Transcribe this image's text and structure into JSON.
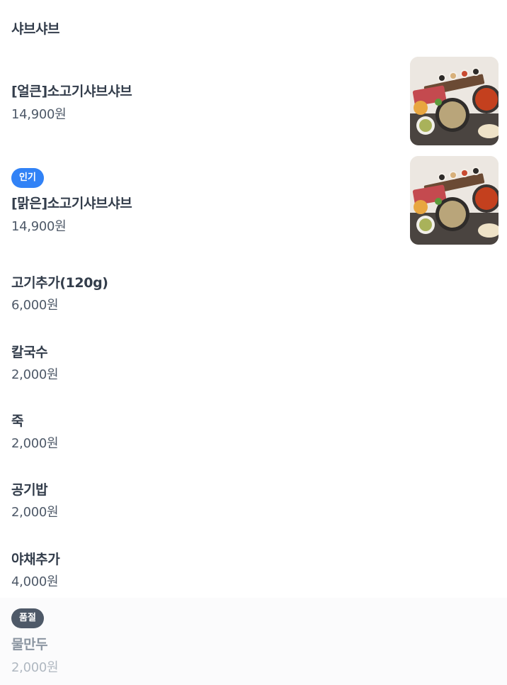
{
  "section": {
    "title": "샤브샤브"
  },
  "items": [
    {
      "name": "[얼큰]소고기샤브샤브",
      "price": "14,900원"
    },
    {
      "badge": "인기",
      "name": "[맑은]소고기샤브샤브",
      "price": "14,900원"
    },
    {
      "name": "고기추가(120g)",
      "price": "6,000원"
    },
    {
      "name": "칼국수",
      "price": "2,000원"
    },
    {
      "name": "죽",
      "price": "2,000원"
    },
    {
      "name": "공기밥",
      "price": "2,000원"
    },
    {
      "name": "야채추가",
      "price": "4,000원"
    },
    {
      "badge": "품절",
      "name": "물만두",
      "price": "2,000원"
    }
  ],
  "colors": {
    "popular_badge": "#3182f6",
    "soldout_badge": "#4e5968"
  }
}
